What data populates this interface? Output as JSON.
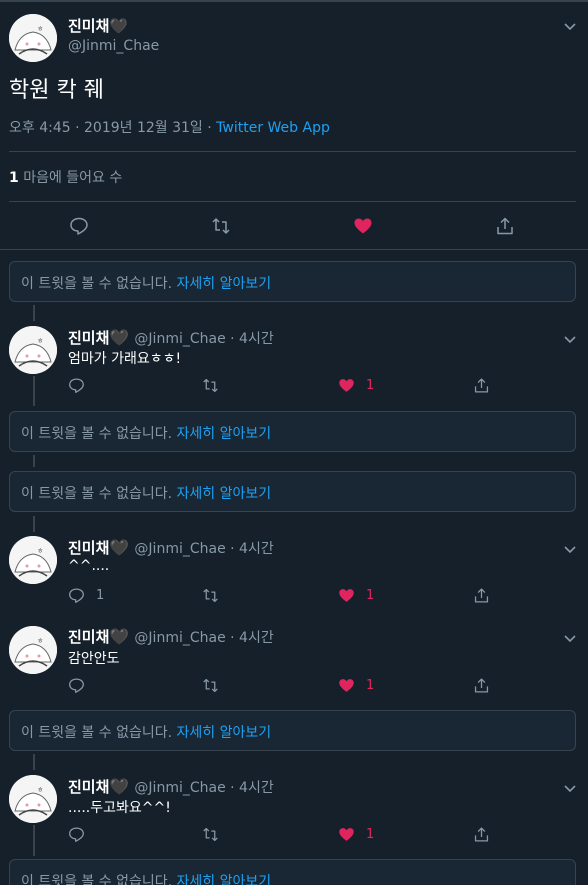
{
  "colors": {
    "background": "#15202b",
    "accent": "#1da1f2",
    "like": "#e0245e",
    "muted": "#8899a6",
    "border": "#38444d"
  },
  "main_tweet": {
    "name": "진미채",
    "heart_glyph": "🖤",
    "handle": "@Jinmi_Chae",
    "text": "학원 칵 줴",
    "time": "오후 4:45 · 2019년 12월 31일 · ",
    "source": "Twitter Web App",
    "likes_count": "1",
    "likes_label": " 마음에 들어요 수",
    "liked": true,
    "icons": [
      "reply-icon",
      "retweet-icon",
      "like-icon",
      "share-icon"
    ]
  },
  "unavailable": {
    "text": "이 트윗을 볼 수 없습니다. ",
    "link": "자세히 알아보기"
  },
  "replies": [
    {
      "name": "진미채",
      "heart_glyph": "🖤",
      "meta": "@Jinmi_Chae · 4시간",
      "text": "엄마가 가래요ㅎㅎ!",
      "reply_count": "",
      "like_count": "1"
    },
    {
      "name": "진미채",
      "heart_glyph": "🖤",
      "meta": "@Jinmi_Chae · 4시간",
      "text": "^^....",
      "reply_count": "1",
      "like_count": "1"
    },
    {
      "name": "진미채",
      "heart_glyph": "🖤",
      "meta": "@Jinmi_Chae · 4시간",
      "text": "감안안도",
      "reply_count": "",
      "like_count": "1"
    },
    {
      "name": "진미채",
      "heart_glyph": "🖤",
      "meta": "@Jinmi_Chae · 4시간",
      "text": ".....두고봐요^^!",
      "reply_count": "",
      "like_count": "1"
    }
  ]
}
